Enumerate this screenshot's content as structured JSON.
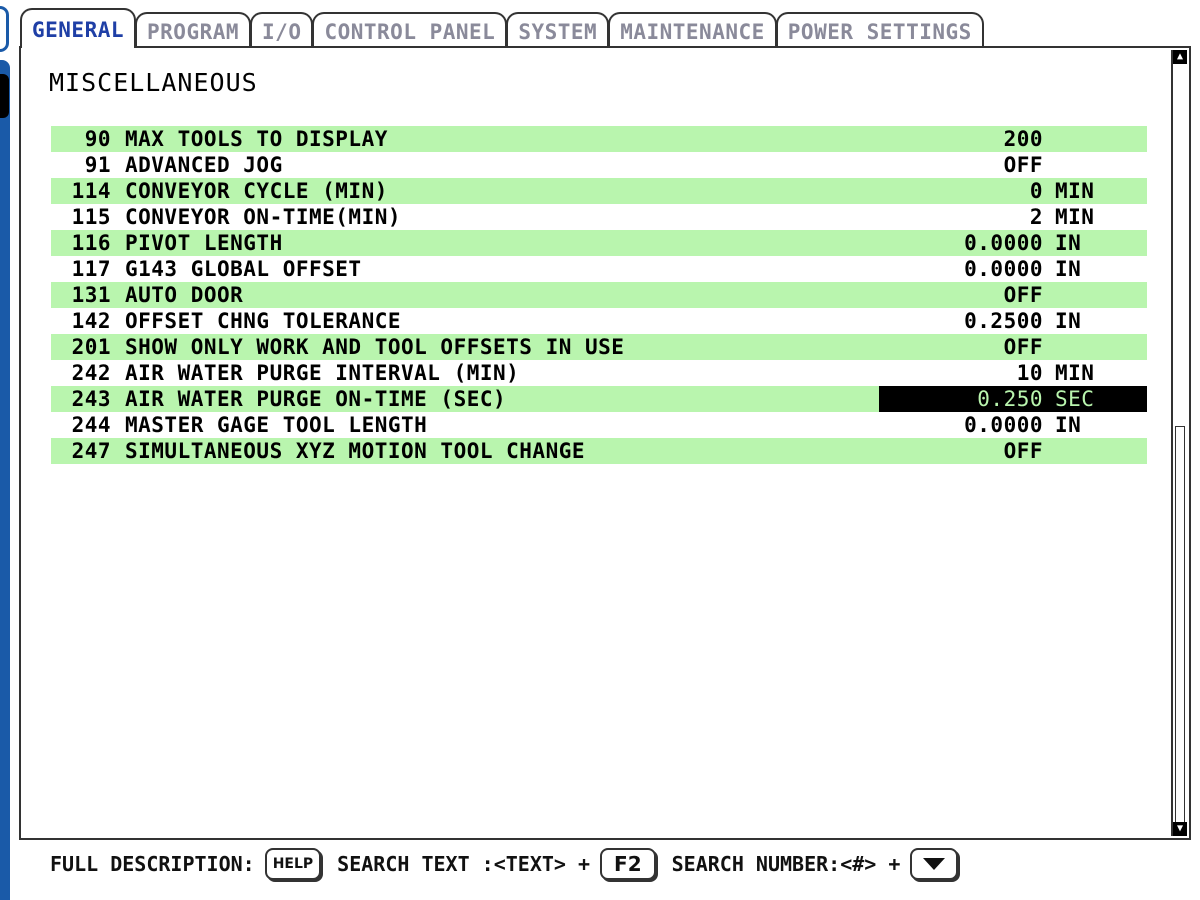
{
  "tabs": [
    {
      "label": "GENERAL",
      "active": true
    },
    {
      "label": "PROGRAM",
      "active": false
    },
    {
      "label": "I/O",
      "active": false
    },
    {
      "label": "CONTROL PANEL",
      "active": false
    },
    {
      "label": "SYSTEM",
      "active": false
    },
    {
      "label": "MAINTENANCE",
      "active": false
    },
    {
      "label": "POWER SETTINGS",
      "active": false
    }
  ],
  "section_title": "MISCELLANEOUS",
  "settings": [
    {
      "num": "90",
      "desc": "MAX TOOLS TO DISPLAY",
      "value": "200",
      "unit": ""
    },
    {
      "num": "91",
      "desc": "ADVANCED JOG",
      "value": "OFF",
      "unit": ""
    },
    {
      "num": "114",
      "desc": "CONVEYOR CYCLE (MIN)",
      "value": "0",
      "unit": "MIN"
    },
    {
      "num": "115",
      "desc": "CONVEYOR ON-TIME(MIN)",
      "value": "2",
      "unit": "MIN"
    },
    {
      "num": "116",
      "desc": "PIVOT LENGTH",
      "value": "0.0000",
      "unit": "IN"
    },
    {
      "num": "117",
      "desc": "G143 GLOBAL OFFSET",
      "value": "0.0000",
      "unit": "IN"
    },
    {
      "num": "131",
      "desc": "AUTO DOOR",
      "value": "OFF",
      "unit": ""
    },
    {
      "num": "142",
      "desc": "OFFSET CHNG TOLERANCE",
      "value": "0.2500",
      "unit": "IN"
    },
    {
      "num": "201",
      "desc": "SHOW ONLY WORK AND TOOL OFFSETS IN USE",
      "value": "OFF",
      "unit": ""
    },
    {
      "num": "242",
      "desc": "AIR WATER PURGE INTERVAL (MIN)",
      "value": "10",
      "unit": "MIN"
    },
    {
      "num": "243",
      "desc": "AIR WATER PURGE ON-TIME (SEC)",
      "value": "0.250",
      "unit": "SEC",
      "selected": true
    },
    {
      "num": "244",
      "desc": "MASTER GAGE TOOL LENGTH",
      "value": "0.0000",
      "unit": "IN"
    },
    {
      "num": "247",
      "desc": "SIMULTANEOUS XYZ MOTION TOOL CHANGE",
      "value": "OFF",
      "unit": ""
    }
  ],
  "footer": {
    "full_description_label": "FULL DESCRIPTION:",
    "help_key": "HELP",
    "search_text_label": "SEARCH TEXT :<TEXT> +",
    "f2_key": "F2",
    "search_number_label": "SEARCH NUMBER:<#> +",
    "down_key_icon": "down-arrow-icon"
  },
  "colors": {
    "stripe": "#b9f5ae",
    "active_tab": "#1f3fa6",
    "inactive_tab": "#8a8a9a",
    "selected_bg": "#000000",
    "selected_fg": "#b9f5ae",
    "left_strip": "#1a5aa8"
  }
}
